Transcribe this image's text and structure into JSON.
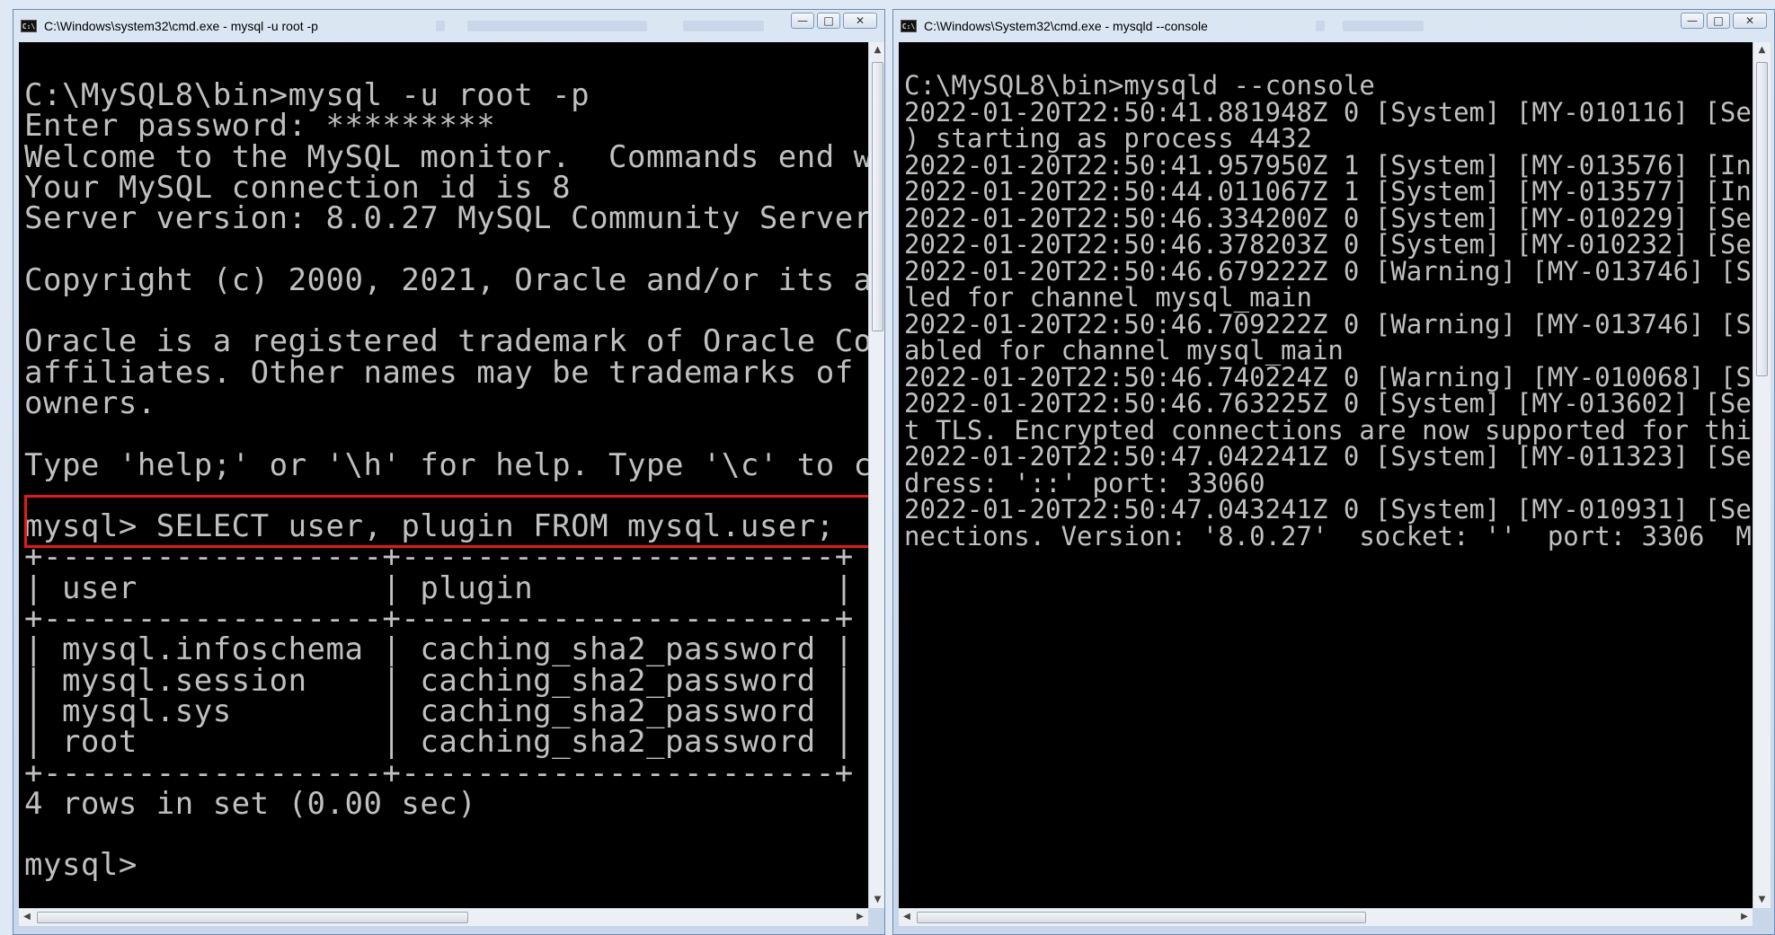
{
  "left_window": {
    "title": "C:\\Windows\\system32\\cmd.exe - mysql  -u root -p",
    "console_text": "C:\\MySQL8\\bin>mysql -u root -p\nEnter password: *********\nWelcome to the MySQL monitor.  Commands end w\nYour MySQL connection id is 8\nServer version: 8.0.27 MySQL Community Server\n\nCopyright (c) 2000, 2021, Oracle and/or its a\n\nOracle is a registered trademark of Oracle Co\naffiliates. Other names may be trademarks of\nowners.\n\nType 'help;' or '\\h' for help. Type '\\c' to c\n\nmysql> SELECT user, plugin FROM mysql.user;\n+------------------+-----------------------+\n| user             | plugin                |\n+------------------+-----------------------+\n| mysql.infoschema | caching_sha2_password |\n| mysql.session    | caching_sha2_password |\n| mysql.sys        | caching_sha2_password |\n| root             | caching_sha2_password |\n+------------------+-----------------------+\n4 rows in set (0.00 sec)\n\nmysql>"
  },
  "right_window": {
    "title": "C:\\Windows\\System32\\cmd.exe - mysqld  --console",
    "console_text": "C:\\MySQL8\\bin>mysqld --console\n2022-01-20T22:50:41.881948Z 0 [System] [MY-010116] [Ser\n) starting as process 4432\n2022-01-20T22:50:41.957950Z 1 [System] [MY-013576] [Inn\n2022-01-20T22:50:44.011067Z 1 [System] [MY-013577] [Inn\n2022-01-20T22:50:46.334200Z 0 [System] [MY-010229] [Ser\n2022-01-20T22:50:46.378203Z 0 [System] [MY-010232] [Ser\n2022-01-20T22:50:46.679222Z 0 [Warning] [MY-013746] [Se\nled for channel mysql_main\n2022-01-20T22:50:46.709222Z 0 [Warning] [MY-013746] [Se\nabled for channel mysql_main\n2022-01-20T22:50:46.740224Z 0 [Warning] [MY-010068] [Se\n2022-01-20T22:50:46.763225Z 0 [System] [MY-013602] [Ser\nt TLS. Encrypted connections are now supported for this\n2022-01-20T22:50:47.042241Z 0 [System] [MY-011323] [Ser\ndress: '::' port: 33060\n2022-01-20T22:50:47.043241Z 0 [System] [MY-010931] [Ser\nnections. Version: '8.0.27'  socket: ''  port: 3306  My"
  },
  "window_controls": {
    "minimize": "—",
    "maximize": "□",
    "close": "✕"
  },
  "scroll_arrows": {
    "up": "▲",
    "down": "▼",
    "left": "◀",
    "right": "▶"
  },
  "icons": {
    "app": "cmd-icon"
  },
  "colors": {
    "highlight_border": "#e11b1b",
    "console_bg": "#000000",
    "console_fg": "#c0c0c0"
  }
}
